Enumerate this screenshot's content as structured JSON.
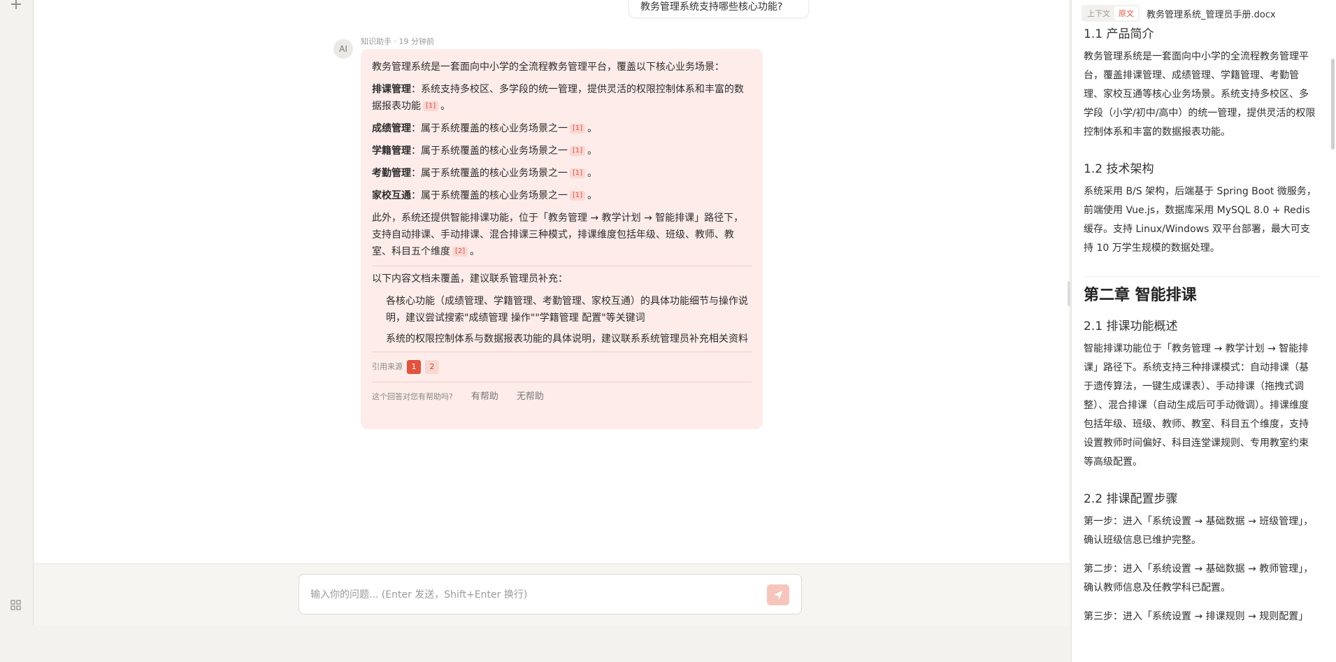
{
  "user_message": "教务管理系统支持哪些核心功能?",
  "ai": {
    "avatar": "AI",
    "meta": "知识助手 · 19 分钟前",
    "intro": "教务管理系统是一套面向中小学的全流程教务管理平台，覆盖以下核心业务场景：",
    "items": [
      {
        "title": "排课管理",
        "text": "：系统支持多校区、多学段的统一管理，提供灵活的权限控制体系和丰富的数据报表功能",
        "cite": "[1]",
        "end": "。"
      },
      {
        "title": "成绩管理",
        "text": "：属于系统覆盖的核心业务场景之一",
        "cite": "[1]",
        "end": "。"
      },
      {
        "title": "学籍管理",
        "text": "：属于系统覆盖的核心业务场景之一",
        "cite": "[1]",
        "end": "。"
      },
      {
        "title": "考勤管理",
        "text": "：属于系统覆盖的核心业务场景之一",
        "cite": "[1]",
        "end": "。"
      },
      {
        "title": "家校互通",
        "text": "：属于系统覆盖的核心业务场景之一",
        "cite": "[1]",
        "end": "。"
      }
    ],
    "extra": "此外，系统还提供智能排课功能，位于「教务管理 → 教学计划 → 智能排课」路径下，支持自动排课、手动排课、混合排课三种模式，排课维度包括年级、班级、教师、教室、科目五个维度",
    "extra_cite": "[2]",
    "extra_end": "。",
    "uncovered_title": "以下内容文档未覆盖，建议联系管理员补充：",
    "uncovered": [
      "各核心功能（成绩管理、学籍管理、考勤管理、家校互通）的具体功能细节与操作说明，建议尝试搜索\"成绩管理 操作\"\"学籍管理 配置\"等关键词",
      "系统的权限控制体系与数据报表功能的具体说明，建议联系系统管理员补充相关资料"
    ],
    "sources_label": "引用来源",
    "sources": [
      "1",
      "2"
    ],
    "feedback_label": "这个回答对您有帮助吗?",
    "helpful": "有帮助",
    "not_helpful": "无帮助"
  },
  "input": {
    "placeholder": "输入你的问题... (Enter 发送，Shift+Enter 换行)"
  },
  "doc": {
    "tab_context": "上下文",
    "tab_original": "原文",
    "filename": "教务管理系统_管理员手册.docx",
    "s11_title": "1.1 产品简介",
    "s11_text": "教务管理系统是一套面向中小学的全流程教务管理平台，覆盖排课管理、成绩管理、学籍管理、考勤管理、家校互通等核心业务场景。系统支持多校区、多学段（小学/初中/高中）的统一管理，提供灵活的权限控制体系和丰富的数据报表功能。",
    "s12_title": "1.2 技术架构",
    "s12_text": "系统采用 B/S 架构，后端基于 Spring Boot 微服务，前端使用 Vue.js，数据库采用 MySQL 8.0 + Redis 缓存。支持 Linux/Windows 双平台部署，最大可支持 10 万学生规模的数据处理。",
    "ch2_title": "第二章 智能排课",
    "s21_title": "2.1 排课功能概述",
    "s21_text": "智能排课功能位于「教务管理 → 教学计划 → 智能排课」路径下。系统支持三种排课模式：自动排课（基于遗传算法，一键生成课表）、手动排课（拖拽式调整）、混合排课（自动生成后可手动微调）。排课维度包括年级、班级、教师、教室、科目五个维度，支持设置教师时间偏好、科目连堂课规则、专用教室约束等高级配置。",
    "s22_title": "2.2 排课配置步骤",
    "step1": "第一步：进入「系统设置 → 基础数据 → 班级管理」，确认班级信息已维护完整。",
    "step2": "第二步：进入「系统设置 → 基础数据 → 教师管理」，确认教师信息及任教学科已配置。",
    "step3": "第三步：进入「系统设置 → 排课规则 → 规则配置」"
  }
}
